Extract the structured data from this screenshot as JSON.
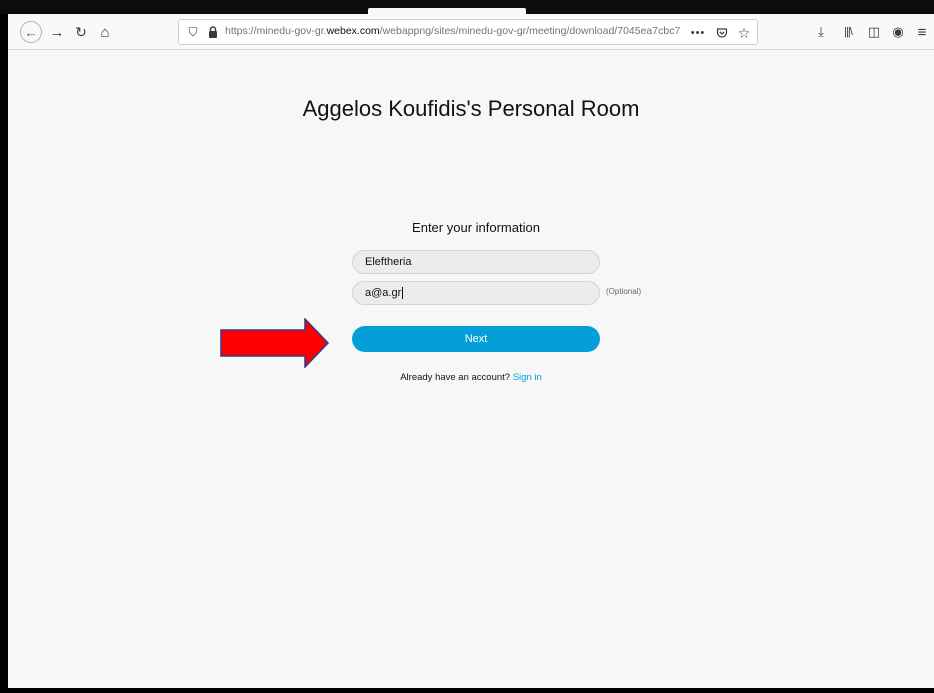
{
  "browser": {
    "url_prefix": "https://minedu-gov-gr.",
    "url_domain": "webex.com",
    "url_path": "/webappng/sites/minedu-gov-gr/meeting/download/7045ea7cbc7",
    "icons": {
      "back": "←",
      "forward": "→",
      "reload": "↻",
      "home": "⌂",
      "shield": "⛉",
      "lock": "🔒",
      "more": "•••",
      "pocket": "♡",
      "star": "☆",
      "download": "⤓",
      "library": "|||\\",
      "sidebar": "◫",
      "account": "◉",
      "menu": "≡"
    }
  },
  "page": {
    "room_title": "Aggelos Koufidis's Personal Room",
    "form_heading": "Enter your information",
    "name_value": "Eleftheria",
    "email_value": "a@a.gr",
    "optional_label": "(Optional)",
    "next_label": "Next",
    "account_prompt": "Already have an account?",
    "signin_label": "Sign in"
  },
  "colors": {
    "accent": "#049fd9",
    "arrow_fill": "#ff0000",
    "arrow_stroke": "#2e3a8c"
  }
}
